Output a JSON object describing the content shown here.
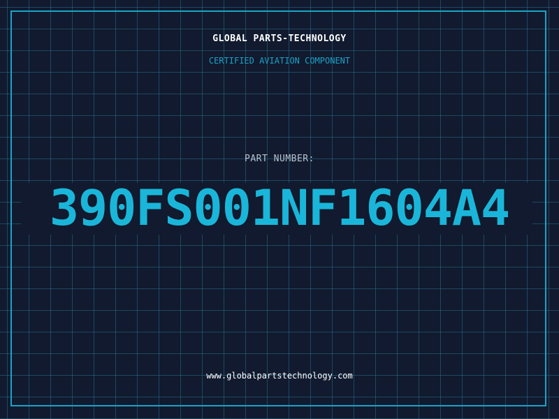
{
  "header": {
    "brand": "GLOBAL PARTS-TECHNOLOGY",
    "subtitle": "CERTIFIED AVIATION COMPONENT"
  },
  "part": {
    "label": "PART NUMBER:",
    "number": "390FS001NF1604A4"
  },
  "footer": {
    "url": "www.globalpartstechnology.com"
  },
  "colors": {
    "background": "#111a2e",
    "grid": "#286e8c",
    "accent": "#1aa3c8",
    "part_number": "#1ab6d9",
    "text": "#ffffff"
  }
}
